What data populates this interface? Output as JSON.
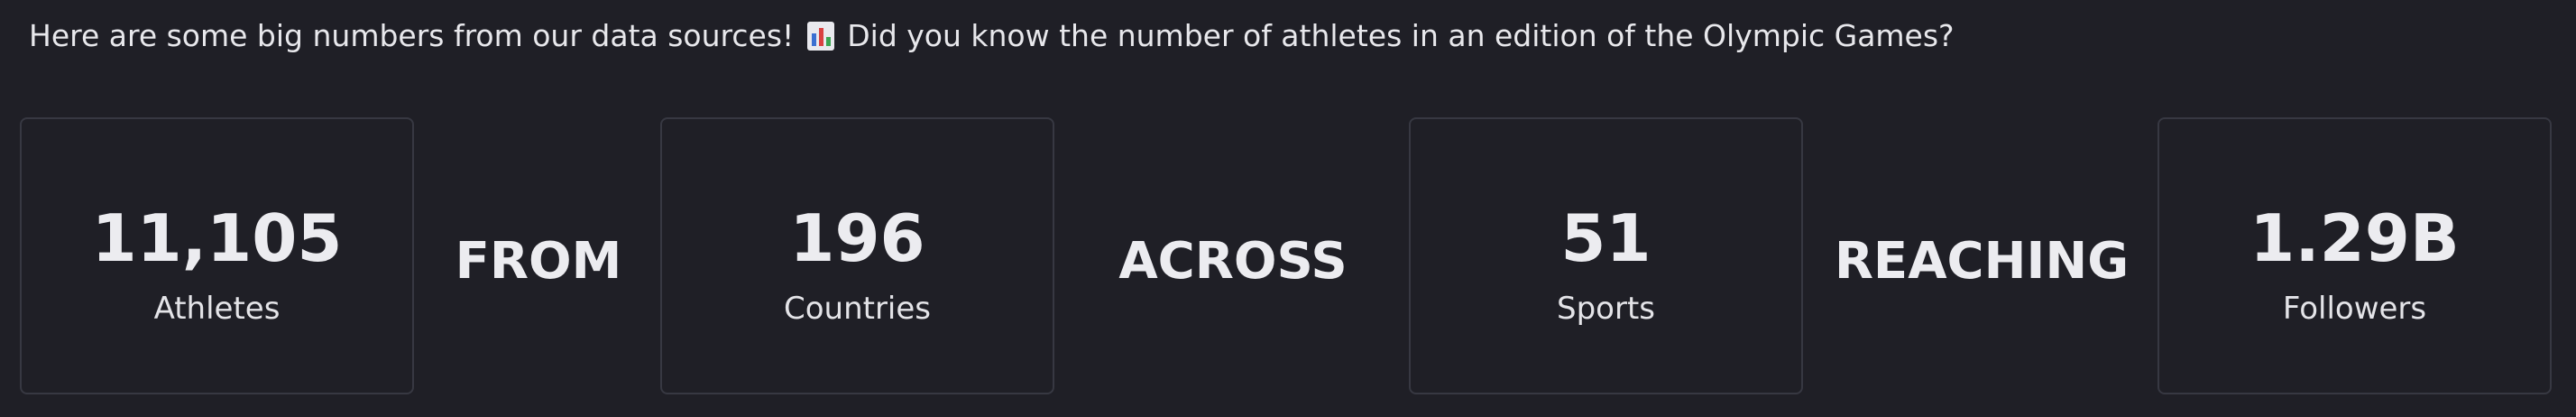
{
  "intro": {
    "text_before": "Here are some big numbers from our data sources!",
    "icon": "bar-chart-emoji-icon",
    "text_after": "Did you know the number of athletes in an edition of the Olympic Games?"
  },
  "stats": [
    {
      "value": "11,105",
      "label": "Athletes"
    },
    {
      "value": "196",
      "label": "Countries"
    },
    {
      "value": "51",
      "label": "Sports"
    },
    {
      "value": "1.29B",
      "label": "Followers"
    }
  ],
  "connectors": [
    "FROM",
    "ACROSS",
    "REACHING"
  ],
  "colors": {
    "background": "#1f1f26",
    "card_border": "#373842",
    "text": "#ececf0"
  }
}
